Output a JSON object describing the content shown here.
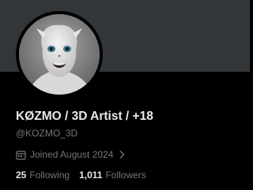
{
  "profile": {
    "display_name": "KØZMO / 3D Artist / +18",
    "handle": "@KOZMO_3D",
    "joined": "Joined August 2024",
    "avatar_alt": "avatar"
  },
  "stats": {
    "following_count": "25",
    "following_label": "Following",
    "followers_count": "1,011",
    "followers_label": "Followers"
  },
  "colors": {
    "background": "#000000",
    "banner": "#333639",
    "primary_text": "#e7e9ea",
    "secondary_text": "#71767b"
  },
  "icons": {
    "joined": "calendar-icon",
    "joined_chevron": "chevron-right-icon"
  }
}
